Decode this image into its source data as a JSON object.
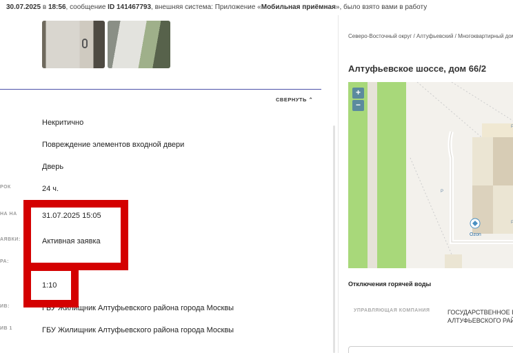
{
  "topbar": {
    "date": "30.07.2025",
    "in": "в",
    "time": "18:56",
    "text1": ", сообщение",
    "id": "ID 141467793",
    "text2": ", внешняя система: Приложение «",
    "system": "Мобильная приёмная",
    "text3": "», было взято вами в работу"
  },
  "details": {
    "collapse_label": "СВЕРНУТЬ",
    "rows": [
      {
        "label": "",
        "value": "Некритично"
      },
      {
        "label": "",
        "value": "Повреждение элементов входной двери"
      },
      {
        "label": "",
        "value": "Дверь"
      },
      {
        "label": "РОК",
        "value": "24 ч."
      },
      {
        "label": "НА НА",
        "value": "31.07.2025 15:05"
      },
      {
        "label": "АЯВКИ:",
        "value": "Активная заявка"
      },
      {
        "label": "РА:",
        "value": "-"
      },
      {
        "label": "",
        "value": "1:10"
      },
      {
        "label": "ИВ:",
        "value": "ГБУ Жилищник Алтуфьевского района города Москвы"
      },
      {
        "label": "ИВ 1",
        "value": "ГБУ Жилищник Алтуфьевского района города Москвы"
      }
    ]
  },
  "right": {
    "breadcrumb": "Северо-Восточный округ / Алтуфьевский / Многоквартирный дом",
    "address": "Алтуфьевское шоссе, дом 66/2",
    "map": {
      "zoom_in": "+",
      "zoom_out": "−",
      "poi": "Ozon",
      "parking": "P"
    },
    "hot_water": "Отключения горячей воды",
    "mc_label": "УПРАВЛЯЮЩАЯ КОМПАНИЯ",
    "mc_value_line1": "ГОСУДАРСТВЕННОЕ Б",
    "mc_value_line2": "АЛТУФЬЕВСКОГО РАЙ"
  },
  "colors": {
    "accent_line": "#4a4fa8",
    "highlight": "#d40000",
    "map_green": "#a8d87a"
  }
}
